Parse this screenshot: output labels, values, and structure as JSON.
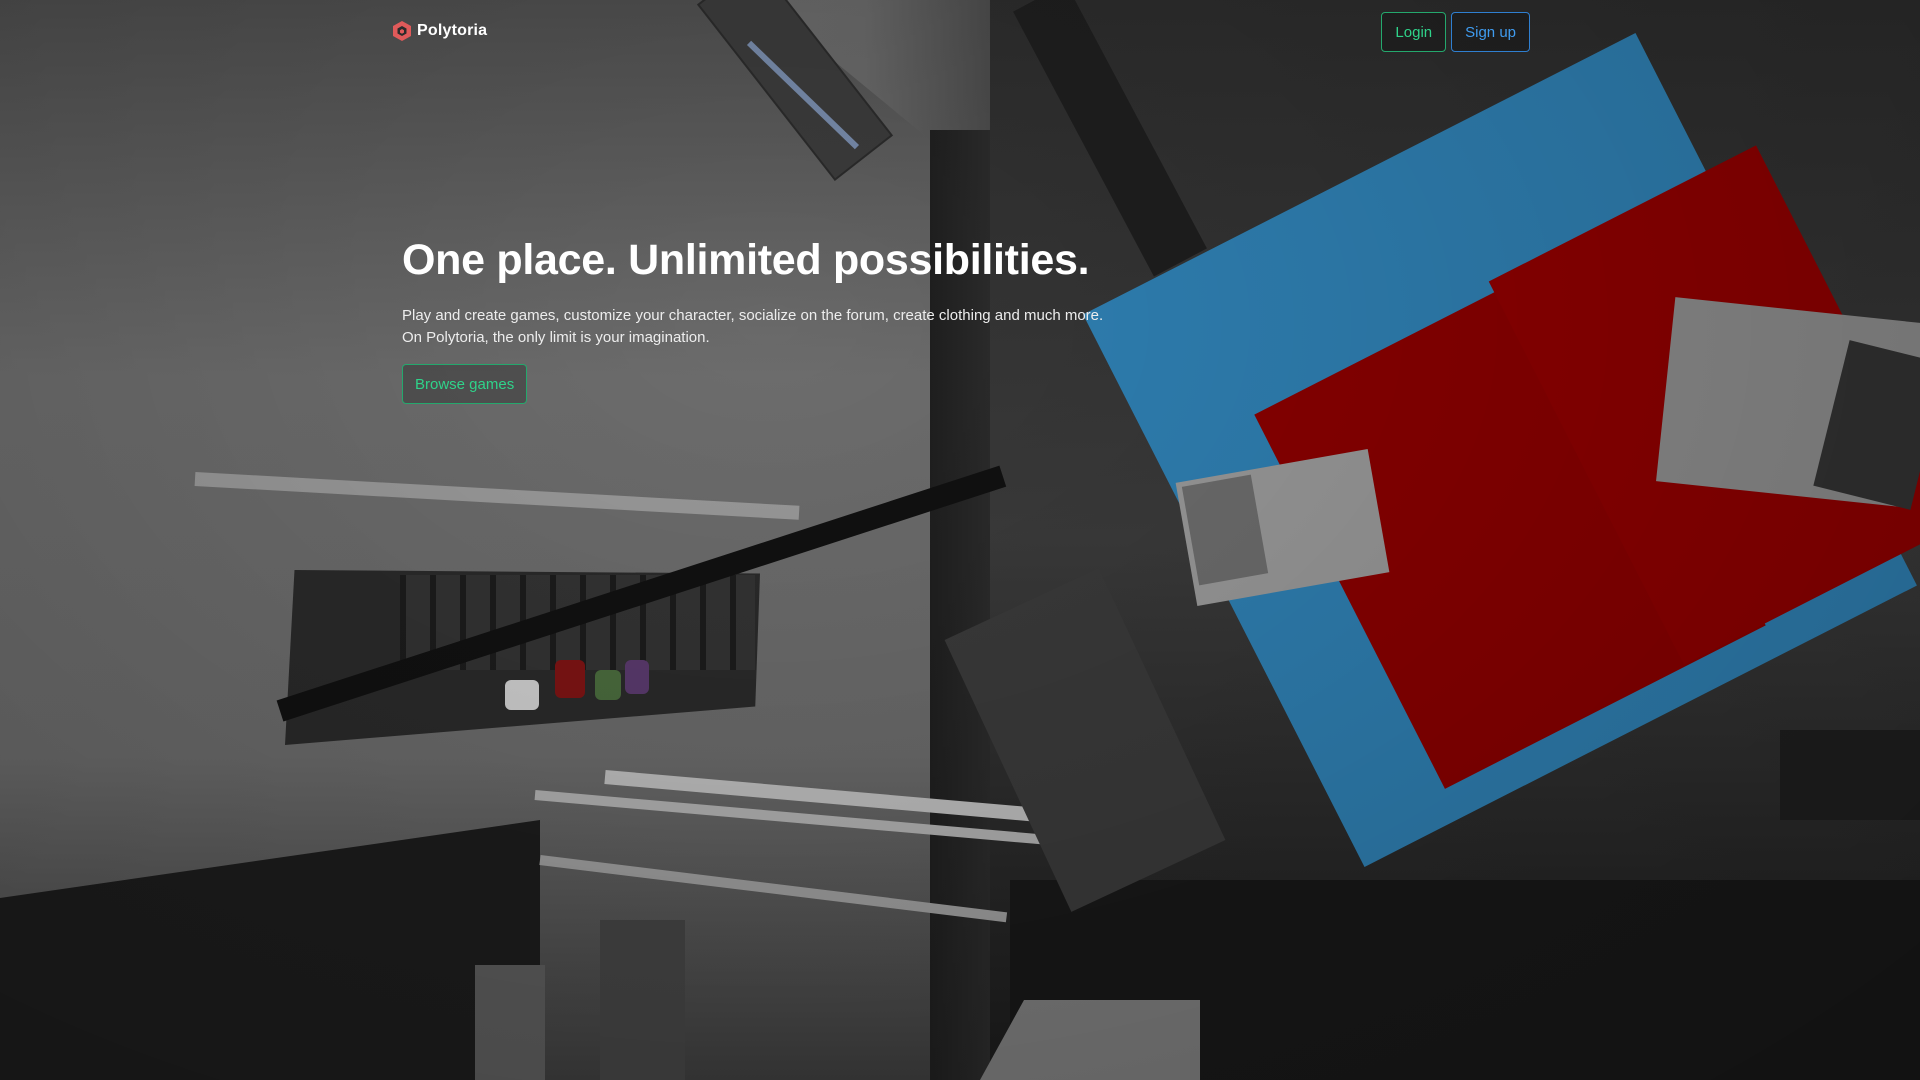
{
  "brand": {
    "name": "Polytoria",
    "logo_icon": "polytoria-logo-icon",
    "logo_color": "#e05a5a"
  },
  "header": {
    "login_label": "Login",
    "signup_label": "Sign up"
  },
  "hero": {
    "title": "One place. Unlimited possibilities.",
    "description_line1": "Play and create games, customize your character, socialize on the forum, create clothing and much more.",
    "description_line2": "On Polytoria, the only limit is your imagination.",
    "browse_label": "Browse games"
  },
  "colors": {
    "login_accent": "#2fd38a",
    "signup_accent": "#3f9cf0",
    "browse_accent": "#2fd38a"
  }
}
